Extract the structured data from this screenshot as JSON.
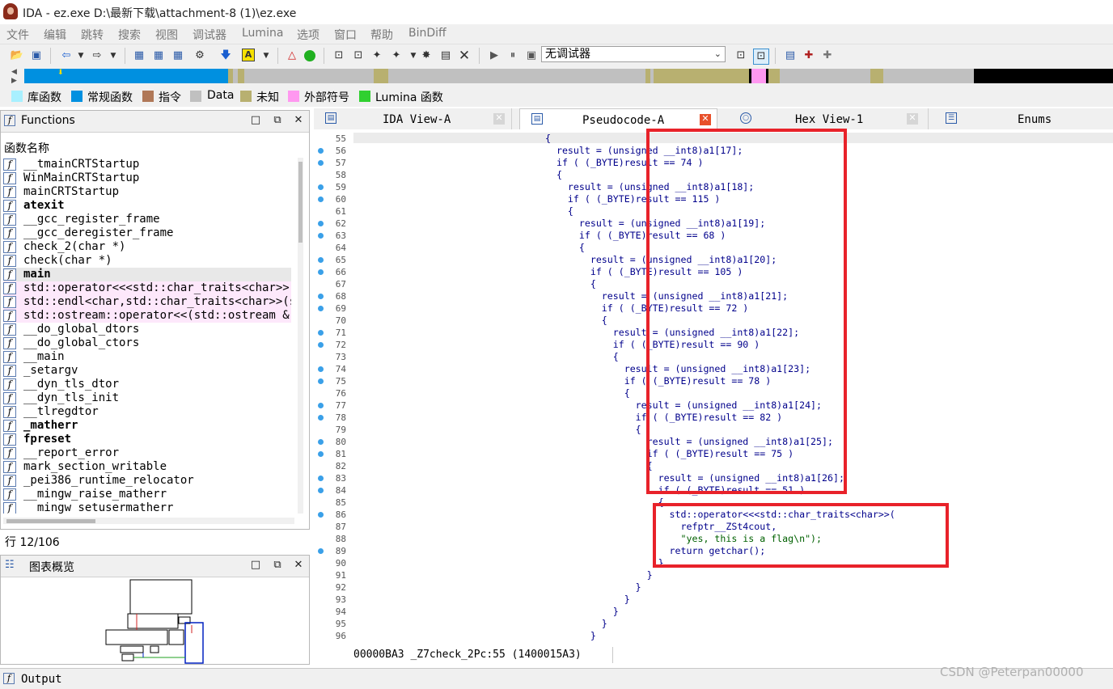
{
  "window": {
    "title": "IDA - ez.exe D:\\最新下载\\attachment-8 (1)\\ez.exe"
  },
  "menu": [
    "文件",
    "编辑",
    "跳转",
    "搜索",
    "视图",
    "调试器",
    "Lumina",
    "选项",
    "窗口",
    "帮助",
    "BinDiff"
  ],
  "toolbar": {
    "debugger_value": "无调试器"
  },
  "legend": [
    {
      "label": "库函数",
      "color": "#a8f0ff"
    },
    {
      "label": "常规函数",
      "color": "#0090e0"
    },
    {
      "label": "指令",
      "color": "#b07858"
    },
    {
      "label": "Data",
      "color": "#c0c0c0"
    },
    {
      "label": "未知",
      "color": "#b8b070"
    },
    {
      "label": "外部符号",
      "color": "#ff98f0"
    },
    {
      "label": "Lumina 函数",
      "color": "#30d030"
    }
  ],
  "functions": {
    "title": "Functions",
    "column": "函数名称",
    "items": [
      "__tmainCRTStartup",
      "WinMainCRTStartup",
      "mainCRTStartup",
      "atexit",
      "__gcc_register_frame",
      "__gcc_deregister_frame",
      "check_2(char *)",
      "check(char *)",
      "main",
      "std::operator<<<std::char_traits<char>>(st",
      "std::endl<char,std::char_traits<char>>(st",
      "std::ostream::operator<<(std::ostream & (*",
      "__do_global_dtors",
      "__do_global_ctors",
      "__main",
      "_setargv",
      "__dyn_tls_dtor",
      "__dyn_tls_init",
      "__tlregdtor",
      "_matherr",
      "fpreset",
      "__report_error",
      "mark_section_writable",
      "_pei386_runtime_relocator",
      "__mingw_raise_matherr",
      "__mingw_setusermatherr"
    ],
    "status": "行 12/106"
  },
  "graph_overview": {
    "title": "图表概览"
  },
  "tabs": [
    {
      "label": "IDA View-A"
    },
    {
      "label": "Pseudocode-A"
    },
    {
      "label": "Hex View-1"
    },
    {
      "label": "Enums"
    }
  ],
  "code": {
    "line_numbers": [
      "55",
      "56",
      "57",
      "58",
      "59",
      "60",
      "61",
      "62",
      "63",
      "64",
      "65",
      "66",
      "67",
      "68",
      "69",
      "70",
      "71",
      "72",
      "73",
      "74",
      "75",
      "76",
      "77",
      "78",
      "79",
      "80",
      "81",
      "82",
      "83",
      "84",
      "85",
      "86",
      "87",
      "88",
      "89",
      "90",
      "91",
      "92",
      "93",
      "94",
      "95",
      "96"
    ],
    "lines": [
      "{",
      "  result = (unsigned __int8)a1[17];",
      "  if ( (_BYTE)result == 74 )",
      "  {",
      "    result = (unsigned __int8)a1[18];",
      "    if ( (_BYTE)result == 115 )",
      "    {",
      "      result = (unsigned __int8)a1[19];",
      "      if ( (_BYTE)result == 68 )",
      "      {",
      "        result = (unsigned __int8)a1[20];",
      "        if ( (_BYTE)result == 105 )",
      "        {",
      "          result = (unsigned __int8)a1[21];",
      "          if ( (_BYTE)result == 72 )",
      "          {",
      "            result = (unsigned __int8)a1[22];",
      "            if ( (_BYTE)result == 90 )",
      "            {",
      "              result = (unsigned __int8)a1[23];",
      "              if ( (_BYTE)result == 78 )",
      "              {",
      "                result = (unsigned __int8)a1[24];",
      "                if ( (_BYTE)result == 82 )",
      "                {",
      "                  result = (unsigned __int8)a1[25];",
      "                  if ( (_BYTE)result == 75 )",
      "                  {",
      "                    result = (unsigned __int8)a1[26];",
      "                    if ( (_BYTE)result == 51 )",
      "                    {",
      "                      std::operator<<<std::char_traits<char>>(",
      "                        refptr__ZSt4cout,",
      "                        \"yes, this is a flag\\n\");",
      "                      return getchar();",
      "                    }",
      "                  }",
      "                }",
      "              }",
      "            }",
      "          }",
      "        }"
    ],
    "status": "00000BA3 _Z7check_2Pc:55 (1400015A3)"
  },
  "output": {
    "title": "Output"
  },
  "watermark": "CSDN @Peterpan00000"
}
